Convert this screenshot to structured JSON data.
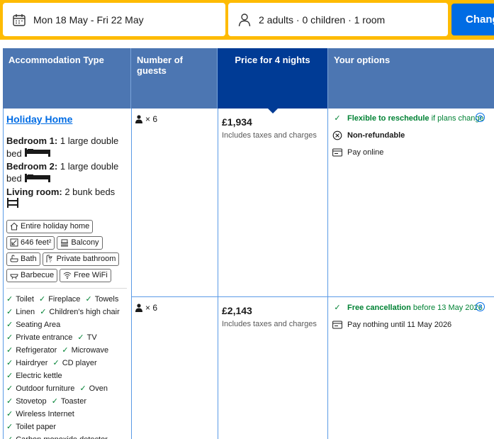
{
  "search": {
    "dates": "Mon 18 May - Fri 22 May",
    "occupancy": "2 adults · 0 children · 1 room",
    "change_label": "Change"
  },
  "table": {
    "headers": [
      "Accommodation Type",
      "Number of guests",
      "Price for 4 nights",
      "Your options"
    ]
  },
  "accommodation": {
    "title": "Holiday Home",
    "beds": [
      {
        "room": "Bedroom 1:",
        "desc": "1 large double bed"
      },
      {
        "room": "Bedroom 2:",
        "desc": "1 large double bed"
      },
      {
        "room": "Living room:",
        "desc": "2 bunk beds"
      }
    ],
    "chips": [
      "Entire holiday home",
      "646 feet²",
      "Balcony",
      "Bath",
      "Private bathroom",
      "Barbecue",
      "Free WiFi"
    ],
    "facilities": [
      "Toilet",
      "Fireplace",
      "Towels",
      "Linen",
      "Children's high chair",
      "Seating Area",
      "Private entrance",
      "TV",
      "Refrigerator",
      "Microwave",
      "Hairdryer",
      "CD player",
      "Electric kettle",
      "Outdoor furniture",
      "Oven",
      "Stovetop",
      "Toaster",
      "Wireless Internet",
      "Toilet paper",
      "Carbon monoxide detector"
    ]
  },
  "rows": [
    {
      "guests": "× 6",
      "price": "£1,934",
      "price_note": "Includes taxes and charges",
      "opt1_bold": "Flexible to reschedule",
      "opt1_rest": " if plans change",
      "opt2": "Non-refundable",
      "opt3": "Pay online"
    },
    {
      "guests": "× 6",
      "price": "£2,143",
      "price_note": "Includes taxes and charges",
      "opt1_bold": "Free cancellation",
      "opt1_rest": " before 13 May 2026",
      "opt2": "Pay nothing until 11 May 2026"
    }
  ],
  "colors": {
    "search_border": "#febb02",
    "primary_button": "#006ce4",
    "header_bg": "#4c76b2",
    "selected_header_bg": "#003b95",
    "accent_green": "#008234",
    "link_blue": "#006ce4"
  }
}
